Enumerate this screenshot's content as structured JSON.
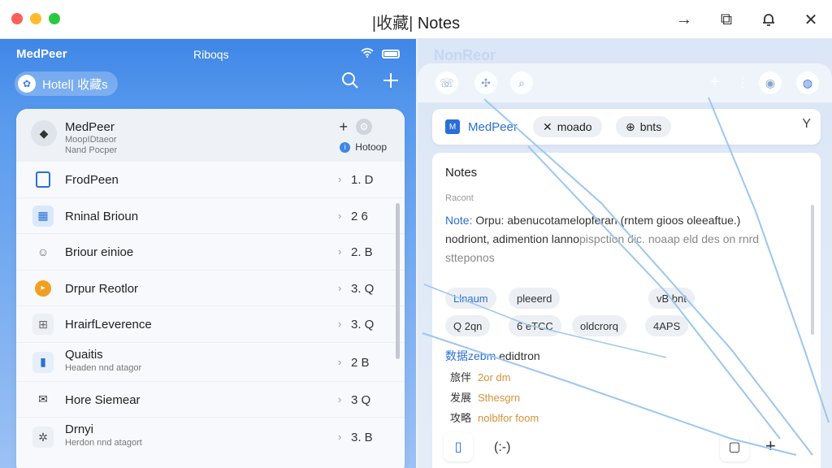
{
  "window": {
    "title_cn": "|收藏|",
    "title": "Notes",
    "actions": [
      "→",
      "⧉",
      "🔔",
      "✕"
    ]
  },
  "left": {
    "status": {
      "app": "MedPeer",
      "center": "Riboqs"
    },
    "pill": {
      "label": "Hotel| 收藏s"
    },
    "header": {
      "name": "MedPeer",
      "sub1": "MoopIDtaeor",
      "sub2": "Nand Pocper",
      "hotkey": "Hotoop"
    },
    "items": [
      {
        "label": "FrodPeen",
        "sub": "",
        "value": "1. D",
        "icon_color": "#2a6fd6"
      },
      {
        "label": "Rninal Brioun",
        "sub": "",
        "value": "2 6",
        "icon_color": "#2a6fd6"
      },
      {
        "label": "Briour einioe",
        "sub": "",
        "value": "2. B",
        "icon_color": "#666666"
      },
      {
        "label": "Drpur Reotlor",
        "sub": "",
        "value": "3. Q",
        "icon_color": "#f0a020"
      },
      {
        "label": "HrairfLeverence",
        "sub": "",
        "value": "3. Q",
        "icon_color": "#666666"
      },
      {
        "label": "Quaitis",
        "sub": "Headen nnd atagor",
        "value": "2 B",
        "icon_color": "#2a6fd6"
      },
      {
        "label": "Hore Siemear",
        "sub": "",
        "value": "3 Q",
        "icon_color": "#333333"
      },
      {
        "label": "Drnyi",
        "sub": "Herdon nnd atagort",
        "value": "3. B",
        "icon_color": "#555555"
      }
    ]
  },
  "right": {
    "ghost": "NonReor",
    "chipbar": {
      "brand": "MedPeer",
      "chip1": "moado",
      "chip2": "bnts"
    },
    "notes": {
      "title": "Notes",
      "meta": "Racont",
      "line1_key": "Note:",
      "line1_rest": " Orpu: abenucotamelopferan (rntem gioos oleeaftue.)",
      "line2": "nodriont, adimention lanno",
      "line2_muted": "pispction dic. noaap eld des on rnrd",
      "line3": "stteponos",
      "tags": [
        "Llnaum",
        "pleeerd",
        "vB bnt",
        "Q 2qn",
        "6 eTCC",
        "oldcrorq",
        "4APS"
      ],
      "section_key": "数据zebm",
      "section_rest": " edidtron",
      "lines": [
        {
          "k": "旅伴",
          "v": "2or dm"
        },
        {
          "k": "发展",
          "v": "Sthesgrn"
        },
        {
          "k": "攻略",
          "v": "nolblfor foom"
        }
      ]
    },
    "bottom": {
      "mid": "(:-)"
    }
  }
}
